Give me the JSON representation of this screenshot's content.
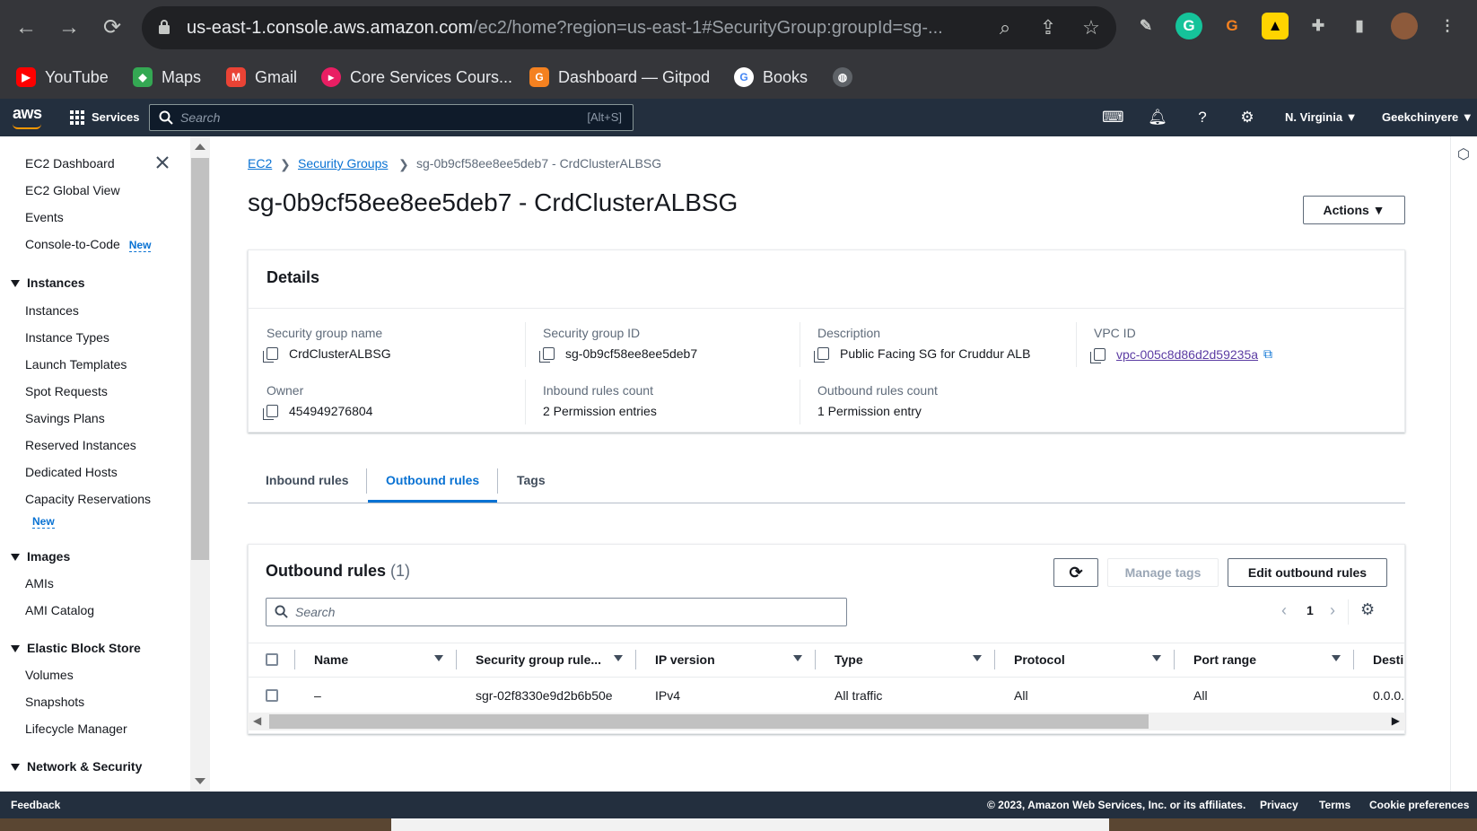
{
  "browser": {
    "url_host": "us-east-1.console.aws.amazon.com",
    "url_path": "/ec2/home?region=us-east-1#SecurityGroup:groupId=sg-...",
    "bookmarks": [
      "YouTube",
      "Maps",
      "Gmail",
      "Core Services Cours...",
      "Dashboard — Gitpod",
      "Books"
    ]
  },
  "aws_bar": {
    "logo": "aws",
    "services_label": "Services",
    "search_placeholder": "Search",
    "search_shortcut": "[Alt+S]",
    "region": "N. Virginia ▼",
    "account": "Geekchinyere ▼"
  },
  "sidebar": {
    "top_items": [
      "EC2 Dashboard",
      "EC2 Global View",
      "Events",
      "Console-to-Code"
    ],
    "new_badge": "New",
    "sections": {
      "instances": "Instances",
      "images": "Images",
      "ebs": "Elastic Block Store",
      "network": "Network & Security"
    },
    "instances_items": [
      "Instances",
      "Instance Types",
      "Launch Templates",
      "Spot Requests",
      "Savings Plans",
      "Reserved Instances",
      "Dedicated Hosts",
      "Capacity Reservations"
    ],
    "images_items": [
      "AMIs",
      "AMI Catalog"
    ],
    "ebs_items": [
      "Volumes",
      "Snapshots",
      "Lifecycle Manager"
    ]
  },
  "breadcrumb": [
    "EC2",
    "Security Groups",
    "sg-0b9cf58ee8ee5deb7 - CrdClusterALBSG"
  ],
  "page_title": "sg-0b9cf58ee8ee5deb7 - CrdClusterALBSG",
  "actions_label": "Actions ▼",
  "details": {
    "title": "Details",
    "sg_name_label": "Security group name",
    "sg_name": "CrdClusterALBSG",
    "sg_id_label": "Security group ID",
    "sg_id": "sg-0b9cf58ee8ee5deb7",
    "description_label": "Description",
    "description": "Public Facing SG for Cruddur ALB",
    "vpc_label": "VPC ID",
    "vpc_id": "vpc-005c8d86d2d59235a",
    "owner_label": "Owner",
    "owner": "454949276804",
    "inbound_label": "Inbound rules count",
    "inbound": "2 Permission entries",
    "outbound_label": "Outbound rules count",
    "outbound": "1 Permission entry"
  },
  "tabs": [
    "Inbound rules",
    "Outbound rules",
    "Tags"
  ],
  "rules_panel": {
    "title": "Outbound rules",
    "count": "(1)",
    "manage_tags": "Manage tags",
    "edit_rules": "Edit outbound rules",
    "search_placeholder": "Search",
    "page": "1",
    "columns": [
      "Name",
      "Security group rule...",
      "IP version",
      "Type",
      "Protocol",
      "Port range",
      "Desti"
    ],
    "rows": [
      [
        "–",
        "sgr-02f8330e9d2b6b50e",
        "IPv4",
        "All traffic",
        "All",
        "All",
        "0.0.0."
      ]
    ]
  },
  "footer": {
    "feedback": "Feedback",
    "copyright": "© 2023, Amazon Web Services, Inc. or its affiliates.",
    "links": [
      "Privacy",
      "Terms",
      "Cookie preferences"
    ]
  },
  "colors": {
    "aws_nav": "#232f3e",
    "link": "#0972d3",
    "chrome": "#35363a"
  }
}
